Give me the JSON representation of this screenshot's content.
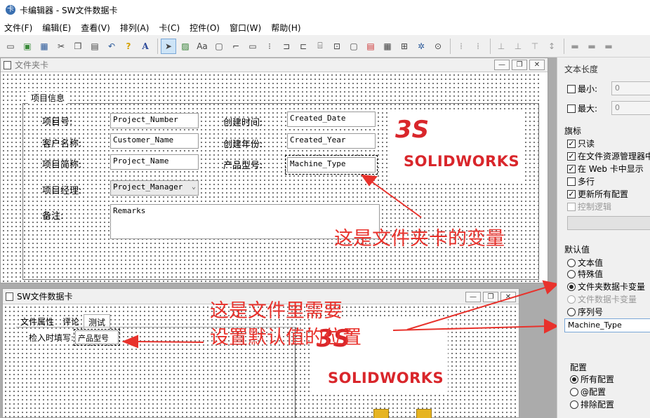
{
  "app": {
    "title": "卡编辑器 - SW文件数据卡",
    "icon": "app-icon"
  },
  "menu": [
    "文件(F)",
    "编辑(E)",
    "查看(V)",
    "排列(A)",
    "卡(C)",
    "控件(O)",
    "窗口(W)",
    "帮助(H)"
  ],
  "toolbar": {
    "icons": [
      "new-icon",
      "open-icon",
      "save-icon",
      "cut-icon",
      "copy-icon",
      "paste-icon",
      "undo-icon",
      "help-icon",
      "font-icon",
      "pointer-icon",
      "image-icon",
      "text-icon",
      "edit-icon",
      "line-icon",
      "checkbox-icon",
      "radio-icon",
      "groupbox-icon",
      "frame-icon",
      "listbox-icon",
      "combobox-icon",
      "pdf-icon",
      "tab-icon",
      "tree-icon",
      "bom-icon",
      "preview-icon",
      "align-left-icon",
      "align-center-icon",
      "align-right-icon",
      "align-top-icon",
      "align-middle-icon",
      "align-bottom-icon",
      "same-width-icon",
      "same-height-icon",
      "same-size-icon"
    ]
  },
  "folder_card": {
    "title": "文件夹卡",
    "group_label": "项目信息",
    "fields": [
      {
        "label": "项目号:",
        "value": "Project_Number"
      },
      {
        "label": "客户名称:",
        "value": "Customer_Name"
      },
      {
        "label": "项目简称:",
        "value": "Project_Name"
      },
      {
        "label": "项目经理:",
        "value": "Project_Manager"
      },
      {
        "label": "创建时间:",
        "value": "Created_Date"
      },
      {
        "label": "创建年份:",
        "value": "Created_Year"
      },
      {
        "label": "产品型号:",
        "value": "Machine_Type"
      },
      {
        "label": "备注:",
        "value": "Remarks"
      }
    ],
    "annotation": "这是文件夹卡的变量"
  },
  "logo": {
    "text": "SOLIDWORKS"
  },
  "file_card": {
    "title": "SW文件数据卡",
    "tabs": [
      "文件属性",
      "评论",
      "测试"
    ],
    "label": "检入时填写:",
    "selected_field": "产品型号",
    "annotation_line1": "这是文件里需要",
    "annotation_line2": "设置默认值的位置"
  },
  "props": {
    "length_label": "文本长度",
    "min_label": "最小:",
    "min_value": "0",
    "max_label": "最大:",
    "max_value": "0",
    "flags_heading": "旗标",
    "flags": [
      {
        "label": "只读",
        "checked": true
      },
      {
        "label": "在文件资源管理器中",
        "checked": true
      },
      {
        "label": "在 Web 卡中显示",
        "checked": true
      },
      {
        "label": "多行",
        "checked": false
      },
      {
        "label": "更新所有配置",
        "checked": true
      },
      {
        "label": "控制逻辑",
        "checked": false,
        "disabled": true
      }
    ],
    "default_heading": "默认值",
    "defaults": [
      {
        "label": "文本值",
        "on": false
      },
      {
        "label": "特殊值",
        "on": false
      },
      {
        "label": "文件夹数据卡变量",
        "on": true
      },
      {
        "label": "文件数据卡变量",
        "on": false,
        "disabled": true
      },
      {
        "label": "序列号",
        "on": false
      }
    ],
    "default_value": "Machine_Type",
    "config_heading": "配置",
    "configs": [
      {
        "label": "所有配置",
        "on": true
      },
      {
        "label": "@配置",
        "on": false
      },
      {
        "label": "排除配置",
        "on": false
      }
    ]
  },
  "colors": {
    "annotation": "#e8322c",
    "logo_red": "#d9262b"
  }
}
